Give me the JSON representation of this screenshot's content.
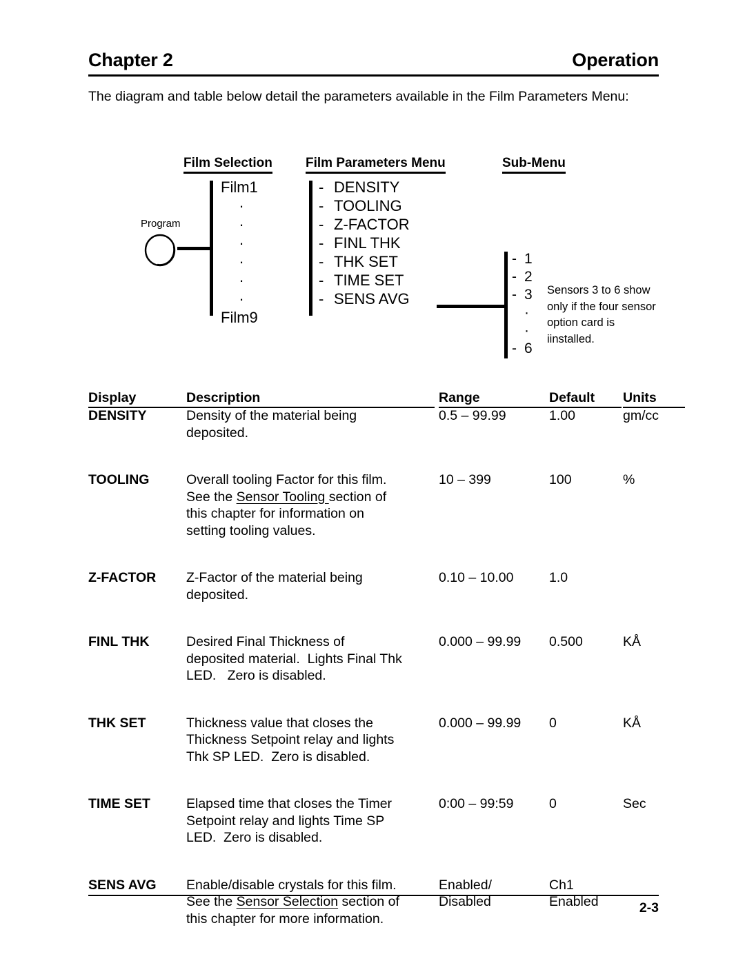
{
  "header": {
    "chapter": "Chapter 2",
    "section": "Operation"
  },
  "intro": "The diagram and table below detail the parameters available in the Film Parameters Menu:",
  "diagram": {
    "column_headings": {
      "film_selection": "Film Selection",
      "film_parameters_menu": "Film Parameters Menu",
      "sub_menu": "Sub-Menu"
    },
    "program_label": "Program",
    "program_icon": "program-key-circle-icon",
    "film_selection_items": [
      "Film1",
      "·",
      "·",
      "·",
      "·",
      "·",
      "·",
      "Film9"
    ],
    "film_parameters_items": [
      "DENSITY",
      "TOOLING",
      "Z-FACTOR",
      "FINL THK",
      "THK SET",
      "TIME SET",
      "SENS AVG"
    ],
    "dash": "-",
    "sub_menu_items": [
      "1",
      "2",
      "3",
      "·",
      "·",
      "6"
    ],
    "sub_menu_note": "Sensors 3 to 6 show only if the four sensor option card is iinstalled."
  },
  "table": {
    "headers": {
      "display": "Display",
      "description": "Description",
      "range": "Range",
      "default": "Default",
      "units": "Units"
    },
    "rows": [
      {
        "display": "DENSITY",
        "description_lines": [
          [
            {
              "t": "Density of the material being"
            }
          ],
          [
            {
              "t": "deposited."
            }
          ]
        ],
        "range": "0.5 – 99.99",
        "default": "1.00",
        "units": "gm/cc"
      },
      {
        "display": "TOOLING",
        "description_lines": [
          [
            {
              "t": "Overall tooling Factor for this film."
            }
          ],
          [
            {
              "t": "See the "
            },
            {
              "t": "Sensor Tooling ",
              "u": true
            },
            {
              "t": "section of"
            }
          ],
          [
            {
              "t": "this chapter for information on"
            }
          ],
          [
            {
              "t": "setting tooling values."
            }
          ]
        ],
        "range": "10 – 399",
        "default": "100",
        "units": "%"
      },
      {
        "display": "Z-FACTOR",
        "description_lines": [
          [
            {
              "t": "Z-Factor of the material being"
            }
          ],
          [
            {
              "t": "deposited."
            }
          ]
        ],
        "range": "0.10 – 10.00",
        "default": "1.0",
        "units": ""
      },
      {
        "display": "FINL THK",
        "description_lines": [
          [
            {
              "t": "Desired Final Thickness of"
            }
          ],
          [
            {
              "t": "deposited material.  Lights Final Thk"
            }
          ],
          [
            {
              "t": "LED.   Zero is disabled."
            }
          ]
        ],
        "range": "0.000 – 99.99",
        "default": "0.500",
        "units": "KÅ"
      },
      {
        "display": "THK SET",
        "description_lines": [
          [
            {
              "t": "Thickness value that closes the"
            }
          ],
          [
            {
              "t": "Thickness Setpoint relay and lights"
            }
          ],
          [
            {
              "t": "Thk SP LED.  Zero is disabled."
            }
          ]
        ],
        "range": "0.000 – 99.99",
        "default": "0",
        "units": "KÅ"
      },
      {
        "display": "TIME SET",
        "description_lines": [
          [
            {
              "t": "Elapsed time that closes the Timer"
            }
          ],
          [
            {
              "t": "Setpoint relay and lights Time SP"
            }
          ],
          [
            {
              "t": "LED.  Zero is disabled."
            }
          ]
        ],
        "range": "0:00 – 99:59",
        "default": "0",
        "units": "Sec"
      },
      {
        "display": "SENS AVG",
        "description_lines": [
          [
            {
              "t": "Enable/disable crystals for this film."
            }
          ],
          [
            {
              "t": "See the "
            },
            {
              "t": "Sensor Selection",
              "u": true
            },
            {
              "t": " section of"
            }
          ],
          [
            {
              "t": "this chapter for more information."
            }
          ]
        ],
        "range": "Enabled/\nDisabled",
        "default": "Ch1\nEnabled",
        "units": ""
      }
    ]
  },
  "footer": {
    "page_number": "2-3"
  }
}
